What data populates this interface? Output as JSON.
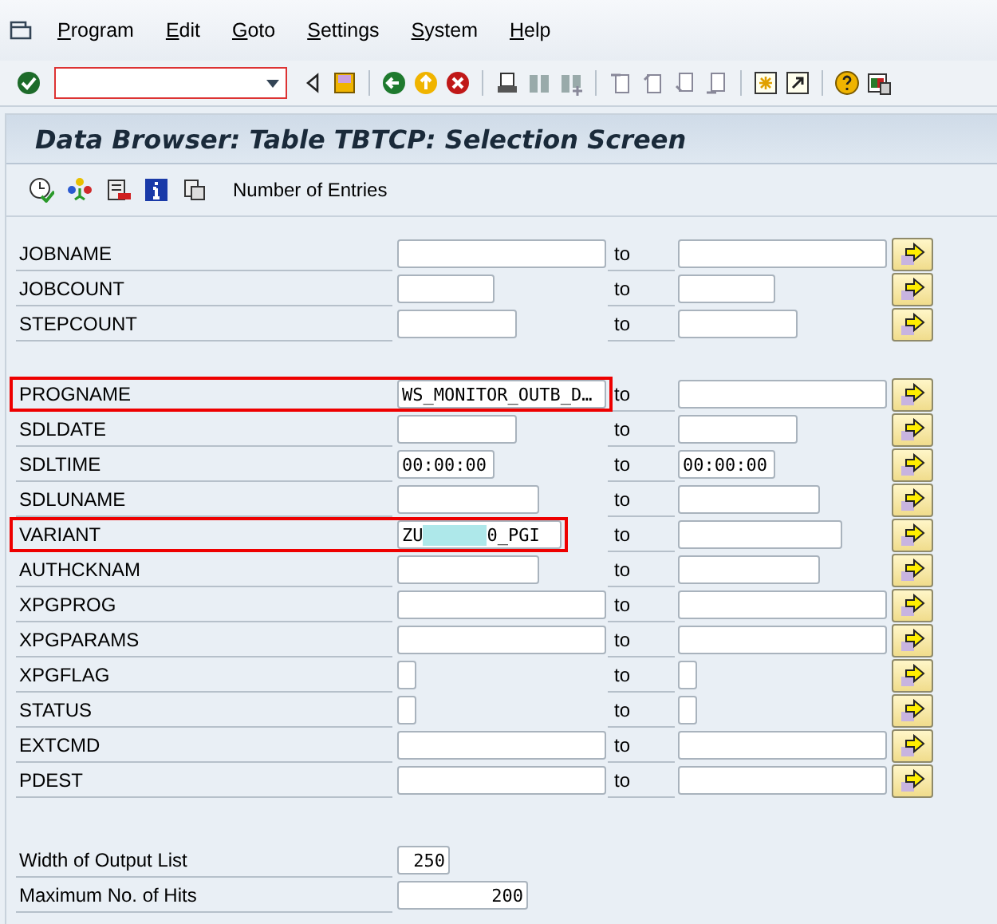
{
  "menu": [
    {
      "label": "Program"
    },
    {
      "label": "Edit"
    },
    {
      "label": "Goto"
    },
    {
      "label": "Settings"
    },
    {
      "label": "System"
    },
    {
      "label": "Help"
    }
  ],
  "title": "Data Browser: Table TBTCP: Selection Screen",
  "app_toolbar": {
    "button_label": "Number of Entries"
  },
  "groups": [
    {
      "rows": [
        {
          "label": "JOBNAME",
          "low": "",
          "separator": "to",
          "high": "",
          "highlighted": false
        },
        {
          "label": "JOBCOUNT",
          "low": "",
          "separator": "to",
          "high": "",
          "highlighted": false
        },
        {
          "label": "STEPCOUNT",
          "low": "",
          "separator": "to",
          "high": "",
          "highlighted": false
        }
      ]
    },
    {
      "rows": [
        {
          "label": "PROGNAME",
          "low": "WS_MONITOR_OUTB_D…",
          "separator": "to",
          "high": "",
          "highlighted": true
        },
        {
          "label": "SDLDATE",
          "low": "",
          "separator": "to",
          "high": "",
          "highlighted": false
        },
        {
          "label": "SDLTIME",
          "low": "00:00:00",
          "separator": "to",
          "high": "00:00:00",
          "highlighted": false
        },
        {
          "label": "SDLUNAME",
          "low": "",
          "separator": "to",
          "high": "",
          "highlighted": false
        },
        {
          "label": "VARIANT",
          "low": "ZU",
          "low_tail": "0_PGI",
          "redacted": true,
          "separator": "to",
          "high": "",
          "highlighted": true
        },
        {
          "label": "AUTHCKNAM",
          "low": "",
          "separator": "to",
          "high": "",
          "highlighted": false
        },
        {
          "label": "XPGPROG",
          "low": "",
          "separator": "to",
          "high": "",
          "highlighted": false
        },
        {
          "label": "XPGPARAMS",
          "low": "",
          "separator": "to",
          "high": "",
          "highlighted": false
        },
        {
          "label": "XPGFLAG",
          "low": "",
          "separator": "to",
          "high": "",
          "highlighted": false
        },
        {
          "label": "STATUS",
          "low": "",
          "separator": "to",
          "high": "",
          "highlighted": false
        },
        {
          "label": "EXTCMD",
          "low": "",
          "separator": "to",
          "high": "",
          "highlighted": false
        },
        {
          "label": "PDEST",
          "low": "",
          "separator": "to",
          "high": "",
          "highlighted": false
        }
      ]
    }
  ],
  "options": [
    {
      "label": "Width of Output List",
      "value": "250"
    },
    {
      "label": "Maximum No. of Hits",
      "value": "200"
    }
  ]
}
